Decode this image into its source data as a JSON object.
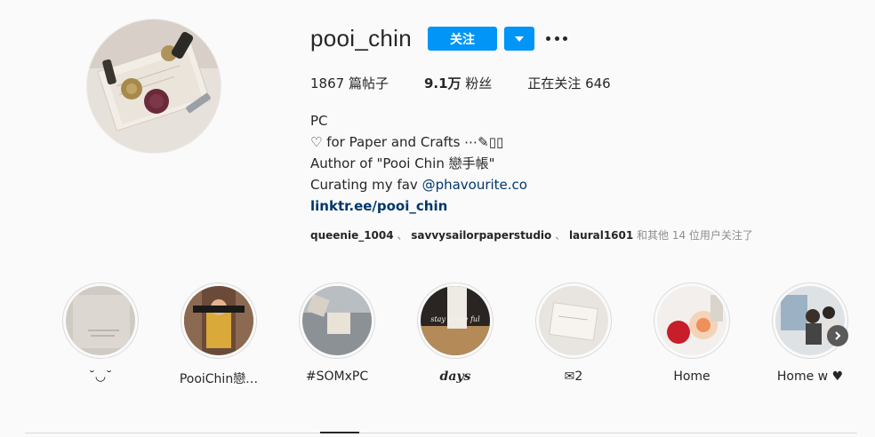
{
  "profile": {
    "username": "pooi_chin",
    "follow_label": "关注",
    "posts": "1867 篇帖子",
    "followers_count": "9.1万",
    "followers_label": " 粉丝",
    "following": "正在关注 646",
    "bio": {
      "name": "PC",
      "line1": "♡ for Paper and Crafts ⋯✎▯▯",
      "line2": "Author of \"Pooi Chin 戀手帳\"",
      "line3_prefix": "Curating my fav ",
      "line3_mention": "@phavourite.co",
      "link": "linktr.ee/pooi_chin"
    },
    "followed_by": {
      "user1": "queenie_1004",
      "sep1": " 、 ",
      "user2": "savvysailorpaperstudio",
      "sep2": " 、 ",
      "user3": "laural1601",
      "suffix": " 和其他 14 位用户关注了"
    }
  },
  "highlights": [
    {
      "label": "˘◡˘",
      "italic": false
    },
    {
      "label": "PooiChin戀…",
      "italic": false
    },
    {
      "label": "#SOMxPC",
      "italic": false
    },
    {
      "label": "days",
      "italic": true
    },
    {
      "label": "✉︎2",
      "italic": false
    },
    {
      "label": "Home",
      "italic": false
    },
    {
      "label": "Home w ♥",
      "italic": false
    }
  ],
  "highlight_3_overlay": "stay grace ful",
  "colors": {
    "accent": "#0095f6",
    "link": "#00376b",
    "muted": "#8e8e8e"
  },
  "icons": [
    "more-options-icon",
    "dropdown-chevron-icon",
    "next-arrow-icon"
  ]
}
